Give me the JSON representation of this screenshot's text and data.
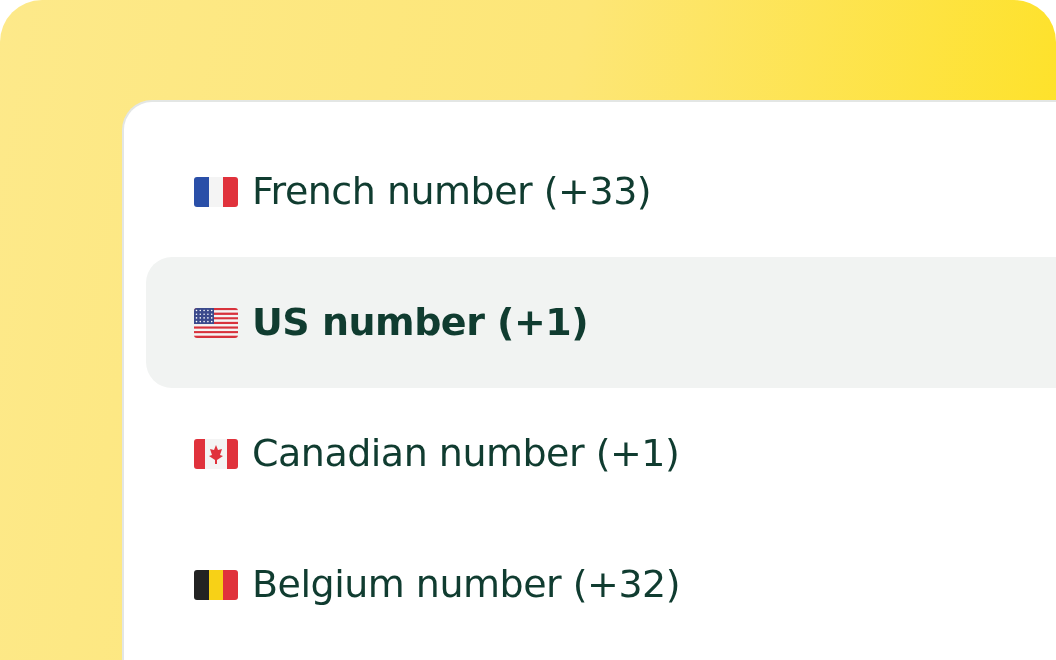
{
  "options": [
    {
      "label": "French number (+33)",
      "selected": false,
      "kind": "france"
    },
    {
      "label": "US number (+1)",
      "selected": true,
      "kind": "usa"
    },
    {
      "label": "Canadian number (+1)",
      "selected": false,
      "kind": "canada"
    },
    {
      "label": "Belgium number (+32)",
      "selected": false,
      "kind": "belgium"
    }
  ]
}
